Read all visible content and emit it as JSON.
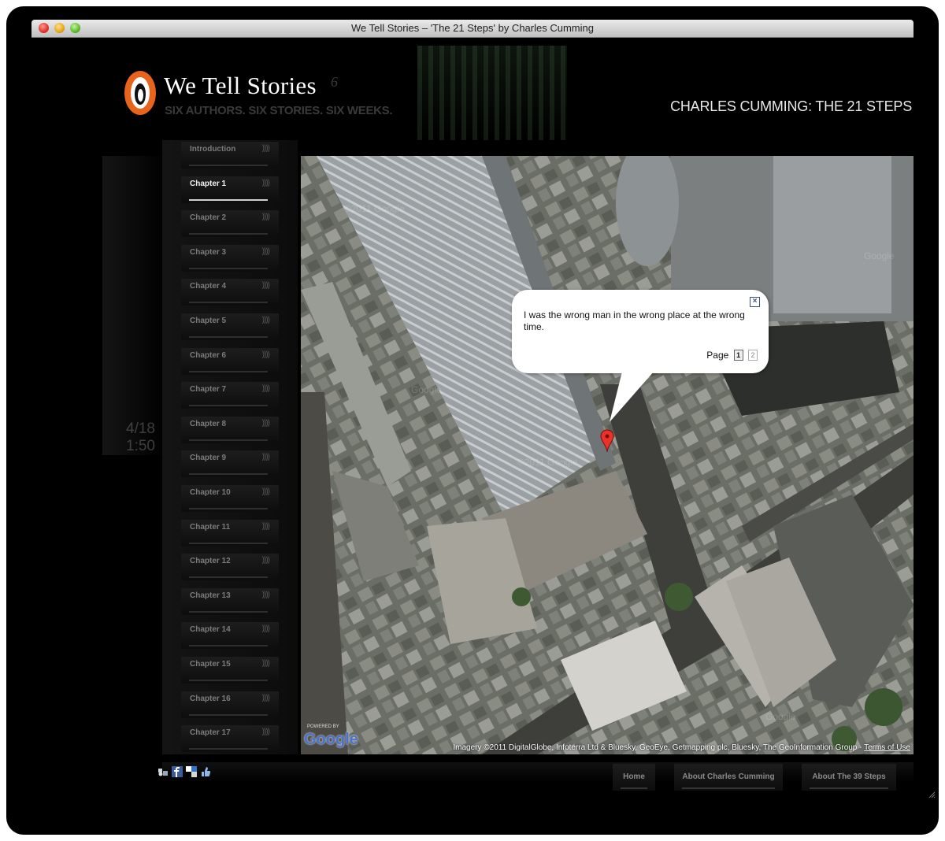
{
  "window": {
    "title": "We Tell Stories – 'The 21 Steps' by Charles Cumming"
  },
  "header": {
    "site_title": "We Tell Stories",
    "site_number": "6",
    "tagline": "SIX AUTHORS. SIX STORIES. SIX WEEKS.",
    "story_heading": "CHARLES CUMMING: THE 21 STEPS"
  },
  "background": {
    "stamp_line1": "4/18",
    "stamp_line2": "1:50"
  },
  "sidebar": {
    "arrow_glyph": "))))",
    "items": [
      {
        "label": "Introduction",
        "active": false
      },
      {
        "label": "Chapter 1",
        "active": true
      },
      {
        "label": "Chapter 2",
        "active": false
      },
      {
        "label": "Chapter 3",
        "active": false
      },
      {
        "label": "Chapter 4",
        "active": false
      },
      {
        "label": "Chapter 5",
        "active": false
      },
      {
        "label": "Chapter 6",
        "active": false
      },
      {
        "label": "Chapter 7",
        "active": false
      },
      {
        "label": "Chapter 8",
        "active": false
      },
      {
        "label": "Chapter 9",
        "active": false
      },
      {
        "label": "Chapter 10",
        "active": false
      },
      {
        "label": "Chapter 11",
        "active": false
      },
      {
        "label": "Chapter 12",
        "active": false
      },
      {
        "label": "Chapter 13",
        "active": false
      },
      {
        "label": "Chapter 14",
        "active": false
      },
      {
        "label": "Chapter 15",
        "active": false
      },
      {
        "label": "Chapter 16",
        "active": false
      },
      {
        "label": "Chapter 17",
        "active": false
      }
    ]
  },
  "map": {
    "watermark": "©2011 Google",
    "watermark_short": "Google",
    "logo_text": "Google",
    "logo_small": "POWERED BY",
    "copyright": "Imagery ©2011 DigitalGlobe, Infoterra Ltd & Bluesky, GeoEye, Getmapping plc, Bluesky, The GeoInformation Group -",
    "terms_label": "Terms of Use",
    "marker_color": "#e8322a",
    "bubble": {
      "close_glyph": "×",
      "text": "I was the wrong man in the wrong place at the wrong time.",
      "page_label": "Page",
      "pages": [
        "1",
        "2"
      ],
      "current_page": "1"
    }
  },
  "footer": {
    "share_icons": [
      "bookmark-icon",
      "facebook-icon",
      "delicious-icon",
      "digg-icon"
    ],
    "links": [
      {
        "label": "Home"
      },
      {
        "label": "About Charles Cumming"
      },
      {
        "label": "About The 39 Steps"
      }
    ]
  }
}
